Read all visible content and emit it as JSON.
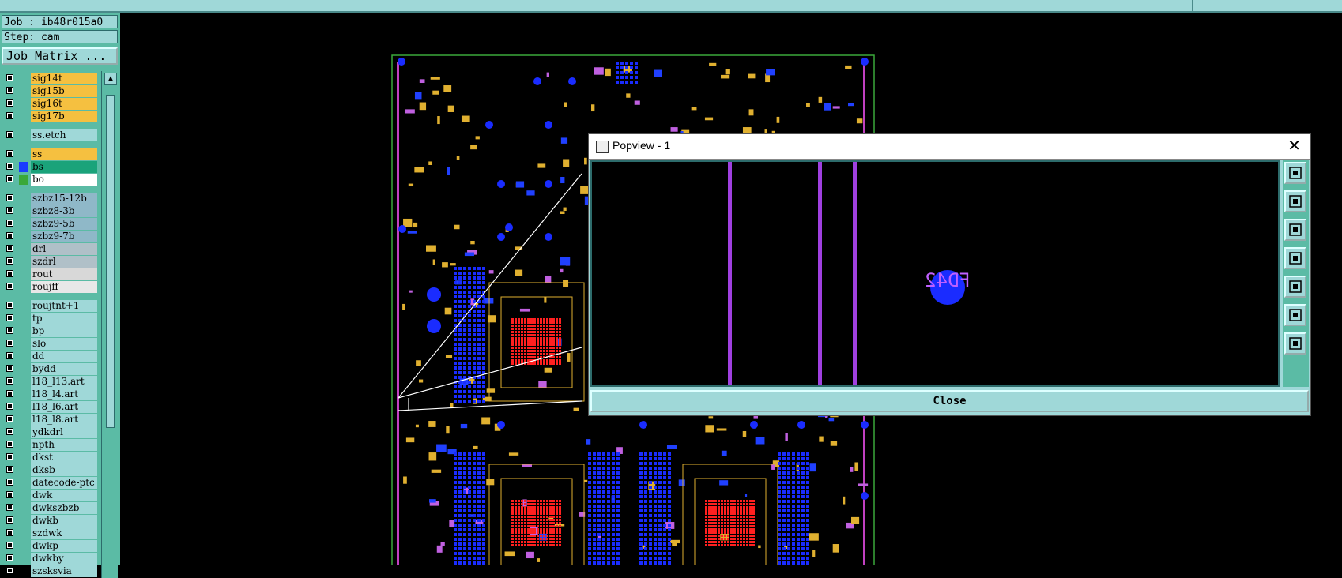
{
  "job_label": "Job : ib48r015a0",
  "step_label": "Step: cam",
  "job_matrix_button": "Job Matrix ...",
  "layers": [
    {
      "name": "sig14t",
      "color": "#f5c040"
    },
    {
      "name": "sig15b",
      "color": "#f5c040"
    },
    {
      "name": "sig16t",
      "color": "#f5c040"
    },
    {
      "name": "sig17b",
      "color": "#f5c040"
    },
    {
      "name": "ss.etch",
      "color": "#9fd8d8"
    },
    {
      "name": "ss",
      "color": "#f5c040"
    },
    {
      "name": "bs",
      "color": "#1aa37a",
      "swatch": "#1a3cff"
    },
    {
      "name": "bo",
      "color": "#ffffff",
      "swatch": "#3aa83a"
    },
    {
      "name": "szbz15-12b",
      "color": "#8fb8c8"
    },
    {
      "name": "szbz8-3b",
      "color": "#8fb8c8"
    },
    {
      "name": "szbz9-5b",
      "color": "#8fb8c8"
    },
    {
      "name": "szbz9-7b",
      "color": "#8fb8c8"
    },
    {
      "name": "drl",
      "color": "#b0c0c8"
    },
    {
      "name": "szdrl",
      "color": "#b0c0c8"
    },
    {
      "name": "rout",
      "color": "#d8d8d8"
    },
    {
      "name": "roujff",
      "color": "#e8e8e8"
    },
    {
      "name": "roujtnt+1",
      "color": "#9fd8d8"
    },
    {
      "name": "tp",
      "color": "#9fd8d8"
    },
    {
      "name": "bp",
      "color": "#9fd8d8"
    },
    {
      "name": "slo",
      "color": "#9fd8d8"
    },
    {
      "name": "dd",
      "color": "#9fd8d8"
    },
    {
      "name": "bydd",
      "color": "#9fd8d8"
    },
    {
      "name": "l18_l13.art",
      "color": "#9fd8d8"
    },
    {
      "name": "l18_l4.art",
      "color": "#9fd8d8"
    },
    {
      "name": "l18_l6.art",
      "color": "#9fd8d8"
    },
    {
      "name": "l18_l8.art",
      "color": "#9fd8d8"
    },
    {
      "name": "ydkdrl",
      "color": "#9fd8d8"
    },
    {
      "name": "npth",
      "color": "#9fd8d8"
    },
    {
      "name": "dkst",
      "color": "#9fd8d8"
    },
    {
      "name": "dksb",
      "color": "#9fd8d8"
    },
    {
      "name": "datecode-ptc",
      "color": "#9fd8d8"
    },
    {
      "name": "dwk",
      "color": "#9fd8d8"
    },
    {
      "name": "dwkszbzb",
      "color": "#9fd8d8"
    },
    {
      "name": "dwkb",
      "color": "#9fd8d8"
    },
    {
      "name": "szdwk",
      "color": "#9fd8d8"
    },
    {
      "name": "dwkp",
      "color": "#9fd8d8"
    },
    {
      "name": "dwkby",
      "color": "#9fd8d8"
    },
    {
      "name": "szsksvia",
      "color": "#9fd8d8"
    }
  ],
  "popup": {
    "title": "Popview - 1",
    "close_label": "Close",
    "pad_text": "FD42",
    "tools": [
      "zoom-window-icon",
      "zoom-in-icon",
      "zoom-out-icon",
      "pan-left-icon",
      "pan-right-icon",
      "fit-icon",
      "zoom-home-icon"
    ]
  }
}
